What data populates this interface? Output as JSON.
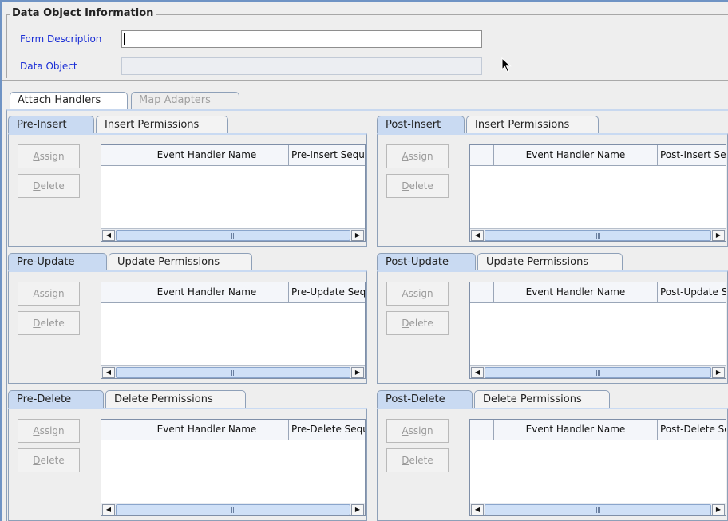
{
  "data_object_info": {
    "title": "Data Object Information",
    "form_description_label": "Form Description",
    "form_description_value": "",
    "data_object_label": "Data Object",
    "data_object_value": ""
  },
  "main_tabs": [
    {
      "label": "Attach Handlers",
      "selected": true,
      "enabled": true
    },
    {
      "label": "Map Adapters",
      "selected": false,
      "enabled": false
    }
  ],
  "buttons": {
    "assign": "Assign",
    "delete": "Delete"
  },
  "columns": {
    "handler_name": "Event Handler Name"
  },
  "panels": [
    {
      "tab_primary": "Pre-Insert",
      "tab_secondary": "Insert Permissions",
      "second_column": "Pre-Insert Sequence"
    },
    {
      "tab_primary": "Post-Insert",
      "tab_secondary": "Insert Permissions",
      "second_column": "Post-Insert Sequence"
    },
    {
      "tab_primary": "Pre-Update",
      "tab_secondary": "Update Permissions",
      "second_column": "Pre-Update Sequence"
    },
    {
      "tab_primary": "Post-Update",
      "tab_secondary": "Update Permissions",
      "second_column": "Post-Update Sequence"
    },
    {
      "tab_primary": "Pre-Delete",
      "tab_secondary": "Delete Permissions",
      "second_column": "Pre-Delete Sequence"
    },
    {
      "tab_primary": "Post-Delete",
      "tab_secondary": "Delete Permissions",
      "second_column": "Post-Delete Sequence"
    }
  ]
}
